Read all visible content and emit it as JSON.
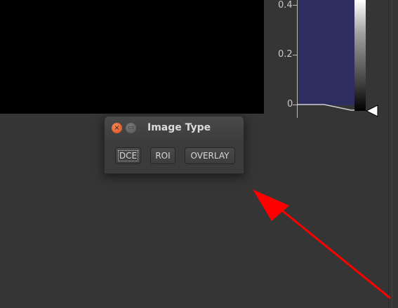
{
  "histogram": {
    "y_ticks": [
      "0.4",
      "0.2",
      "0"
    ]
  },
  "dialog": {
    "title": "Image Type",
    "close_glyph": "×",
    "minimize_glyph": "▭",
    "buttons": {
      "dce": "DCE",
      "roi": "ROI",
      "overlay": "OVERLAY"
    }
  },
  "colors": {
    "background": "#353535",
    "histogram_fill": "#2d2d5f",
    "arrow": "#ff0000",
    "close_button": "#e05a2b"
  }
}
